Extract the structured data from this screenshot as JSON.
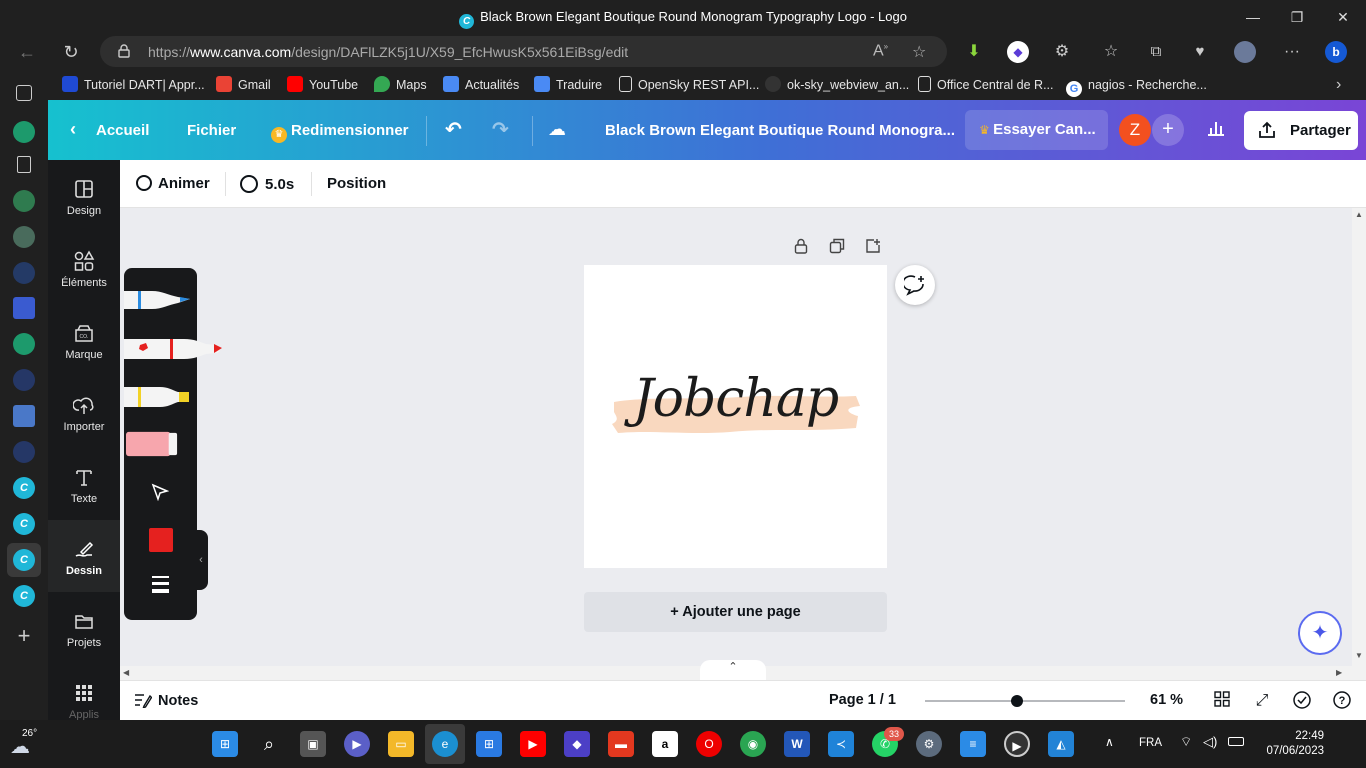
{
  "window": {
    "title": "Black Brown Elegant Boutique Round Monogram Typography Logo - Logo",
    "minimize": "—",
    "restore": "❐",
    "close": "✕"
  },
  "browser": {
    "url_prefix": "https://",
    "url_domain": "www.canva.com",
    "url_path": "/design/DAFlLZK5j1U/X59_EfcHwusK5x561EiBsg/edit",
    "back": "←",
    "refresh": "↻",
    "more": "···"
  },
  "bookmarks": [
    {
      "label": "Tutoriel DART| Appr...",
      "color": "#1f4ad4",
      "icon": "dart-icon"
    },
    {
      "label": "Gmail",
      "color": "#ea4335",
      "icon": "gmail-icon"
    },
    {
      "label": "YouTube",
      "color": "#ff0000",
      "icon": "youtube-icon"
    },
    {
      "label": "Maps",
      "color": "#34a853",
      "icon": "maps-icon"
    },
    {
      "label": "Actualités",
      "color": "#4a8af4",
      "icon": "news-icon"
    },
    {
      "label": "Traduire",
      "color": "#4a8af4",
      "icon": "translate-icon"
    },
    {
      "label": "OpenSky REST API...",
      "color": "#dddddd",
      "icon": "page-icon"
    },
    {
      "label": "ok-sky_webview_an...",
      "color": "#333333",
      "icon": "github-icon"
    },
    {
      "label": "Office Central de R...",
      "color": "#dddddd",
      "icon": "page-icon"
    },
    {
      "label": "nagios - Recherche...",
      "color": "#ffffff",
      "icon": "google-icon"
    }
  ],
  "header": {
    "home": "Accueil",
    "file": "Fichier",
    "resize": "Redimensionner",
    "doc_title": "Black Brown Elegant Boutique Round Monogra...",
    "try_pro": "Essayer Can...",
    "avatar_initial": "Z",
    "share": "Partager"
  },
  "rail": [
    {
      "label": "Design",
      "icon": "design-icon"
    },
    {
      "label": "Éléments",
      "icon": "elements-icon"
    },
    {
      "label": "Marque",
      "icon": "brand-icon"
    },
    {
      "label": "Importer",
      "icon": "upload-icon"
    },
    {
      "label": "Texte",
      "icon": "text-icon"
    },
    {
      "label": "Dessin",
      "icon": "draw-icon"
    },
    {
      "label": "Projets",
      "icon": "projects-icon"
    },
    {
      "label": "Applis",
      "icon": "apps-icon"
    }
  ],
  "toolbar": {
    "animate": "Animer",
    "duration": "5.0s",
    "position": "Position"
  },
  "canvas": {
    "logo_text": "Jobchap",
    "add_page": "+ Ajouter une page",
    "brush_color": "#f9d8bf"
  },
  "draw_panel": {
    "selected_color": "#e5211f",
    "pens": [
      "blue-marker",
      "red-marker",
      "yellow-highlighter",
      "pink-eraser"
    ]
  },
  "footer": {
    "notes": "Notes",
    "page_indicator": "Page 1 / 1",
    "zoom": "61 %",
    "zoom_fraction": 0.46
  },
  "taskbar": {
    "weather_temp": "26°",
    "language": "FRA",
    "time": "22:49",
    "date": "07/06/2023",
    "whatsapp_badge": "33"
  }
}
